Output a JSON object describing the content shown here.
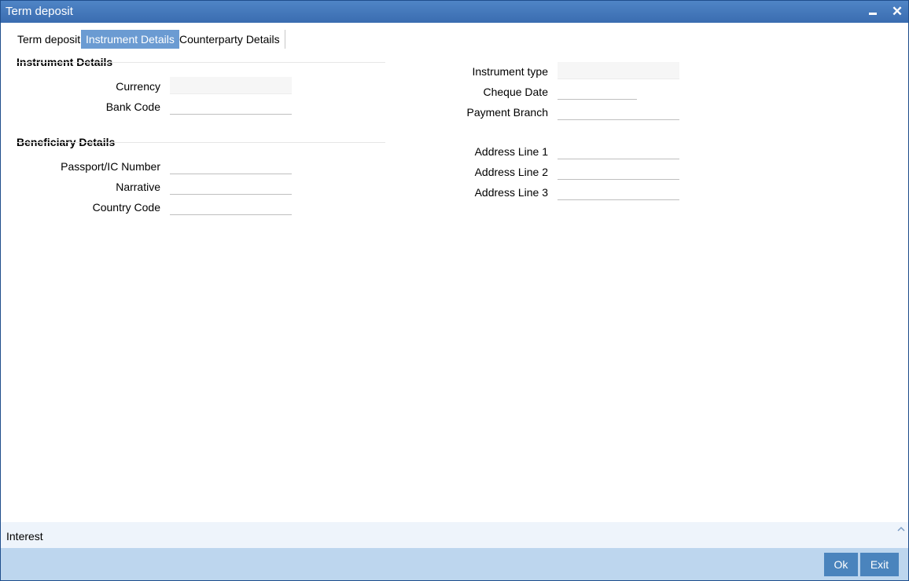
{
  "window": {
    "title": "Term deposit",
    "minimize_glyph": "—",
    "close_glyph": "✕"
  },
  "tabs": [
    {
      "label": "Term deposit",
      "active": false
    },
    {
      "label": "Instrument Details",
      "active": true
    },
    {
      "label": "Counterparty Details",
      "active": false
    }
  ],
  "instrument_section": {
    "title": "Instrument Details",
    "fields": {
      "currency": {
        "label": "Currency",
        "value": ""
      },
      "bank_code": {
        "label": "Bank Code",
        "value": ""
      },
      "instrument_type": {
        "label": "Instrument type",
        "value": ""
      },
      "cheque_date": {
        "label": "Cheque Date",
        "value": ""
      },
      "payment_branch": {
        "label": "Payment Branch",
        "value": ""
      }
    }
  },
  "beneficiary_section": {
    "title": "Beneficiary Details",
    "fields": {
      "passport": {
        "label": "Passport/IC Number",
        "value": ""
      },
      "narrative": {
        "label": "Narrative",
        "value": ""
      },
      "country_code": {
        "label": "Country Code",
        "value": ""
      },
      "address1": {
        "label": "Address Line 1",
        "value": ""
      },
      "address2": {
        "label": "Address Line 2",
        "value": ""
      },
      "address3": {
        "label": "Address Line 3",
        "value": ""
      }
    }
  },
  "interest_bar": {
    "label": "Interest"
  },
  "footer": {
    "ok_label": "Ok",
    "exit_label": "Exit"
  },
  "colors": {
    "titlebar": "#3a6cb0",
    "active_tab": "#6b9bd2",
    "footer": "#bdd6ee",
    "button": "#4a84bd"
  }
}
